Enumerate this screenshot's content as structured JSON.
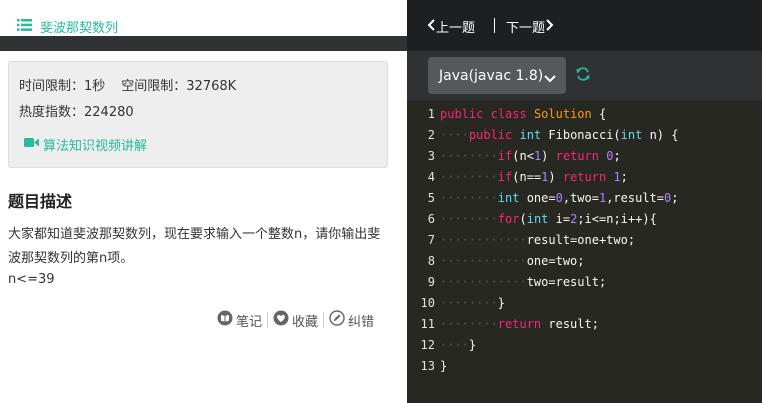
{
  "problem": {
    "title": "斐波那契数列",
    "time_limit": "时间限制：1秒",
    "memory_limit": "空间限制：32768K",
    "popularity": "热度指数：224280",
    "video_link": "算法知识视频讲解",
    "section_title": "题目描述",
    "description": "大家都知道斐波那契数列，现在要求输入一个整数n，请你输出斐波那契数列的第n项。",
    "constraint": "n<=39"
  },
  "actions": {
    "notes": "笔记",
    "favorite": "收藏",
    "report": "纠错"
  },
  "nav": {
    "prev": "上一题",
    "next": "下一题"
  },
  "editor": {
    "language": "Java(javac 1.8)",
    "lines": [
      {
        "n": "1",
        "text": "public class Solution {"
      },
      {
        "n": "2",
        "text": "    public int Fibonacci(int n) {"
      },
      {
        "n": "3",
        "text": "        if(n<1) return 0;"
      },
      {
        "n": "4",
        "text": "        if(n==1) return 1;"
      },
      {
        "n": "5",
        "text": "        int one=0,two=1,result=0;"
      },
      {
        "n": "6",
        "text": "        for(int i=2;i<=n;i++){"
      },
      {
        "n": "7",
        "text": "            result=one+two;"
      },
      {
        "n": "8",
        "text": "            one=two;"
      },
      {
        "n": "9",
        "text": "            two=result;"
      },
      {
        "n": "10",
        "text": "        }"
      },
      {
        "n": "11",
        "text": "        return result;"
      },
      {
        "n": "12",
        "text": "    }"
      },
      {
        "n": "13",
        "text": "}"
      }
    ]
  },
  "colors": {
    "accent": "#25bb9b",
    "editor_bg": "#272822",
    "keyword": "#f92672",
    "type": "#66d9ef",
    "class_name": "#fd971f",
    "number": "#ae81ff"
  }
}
